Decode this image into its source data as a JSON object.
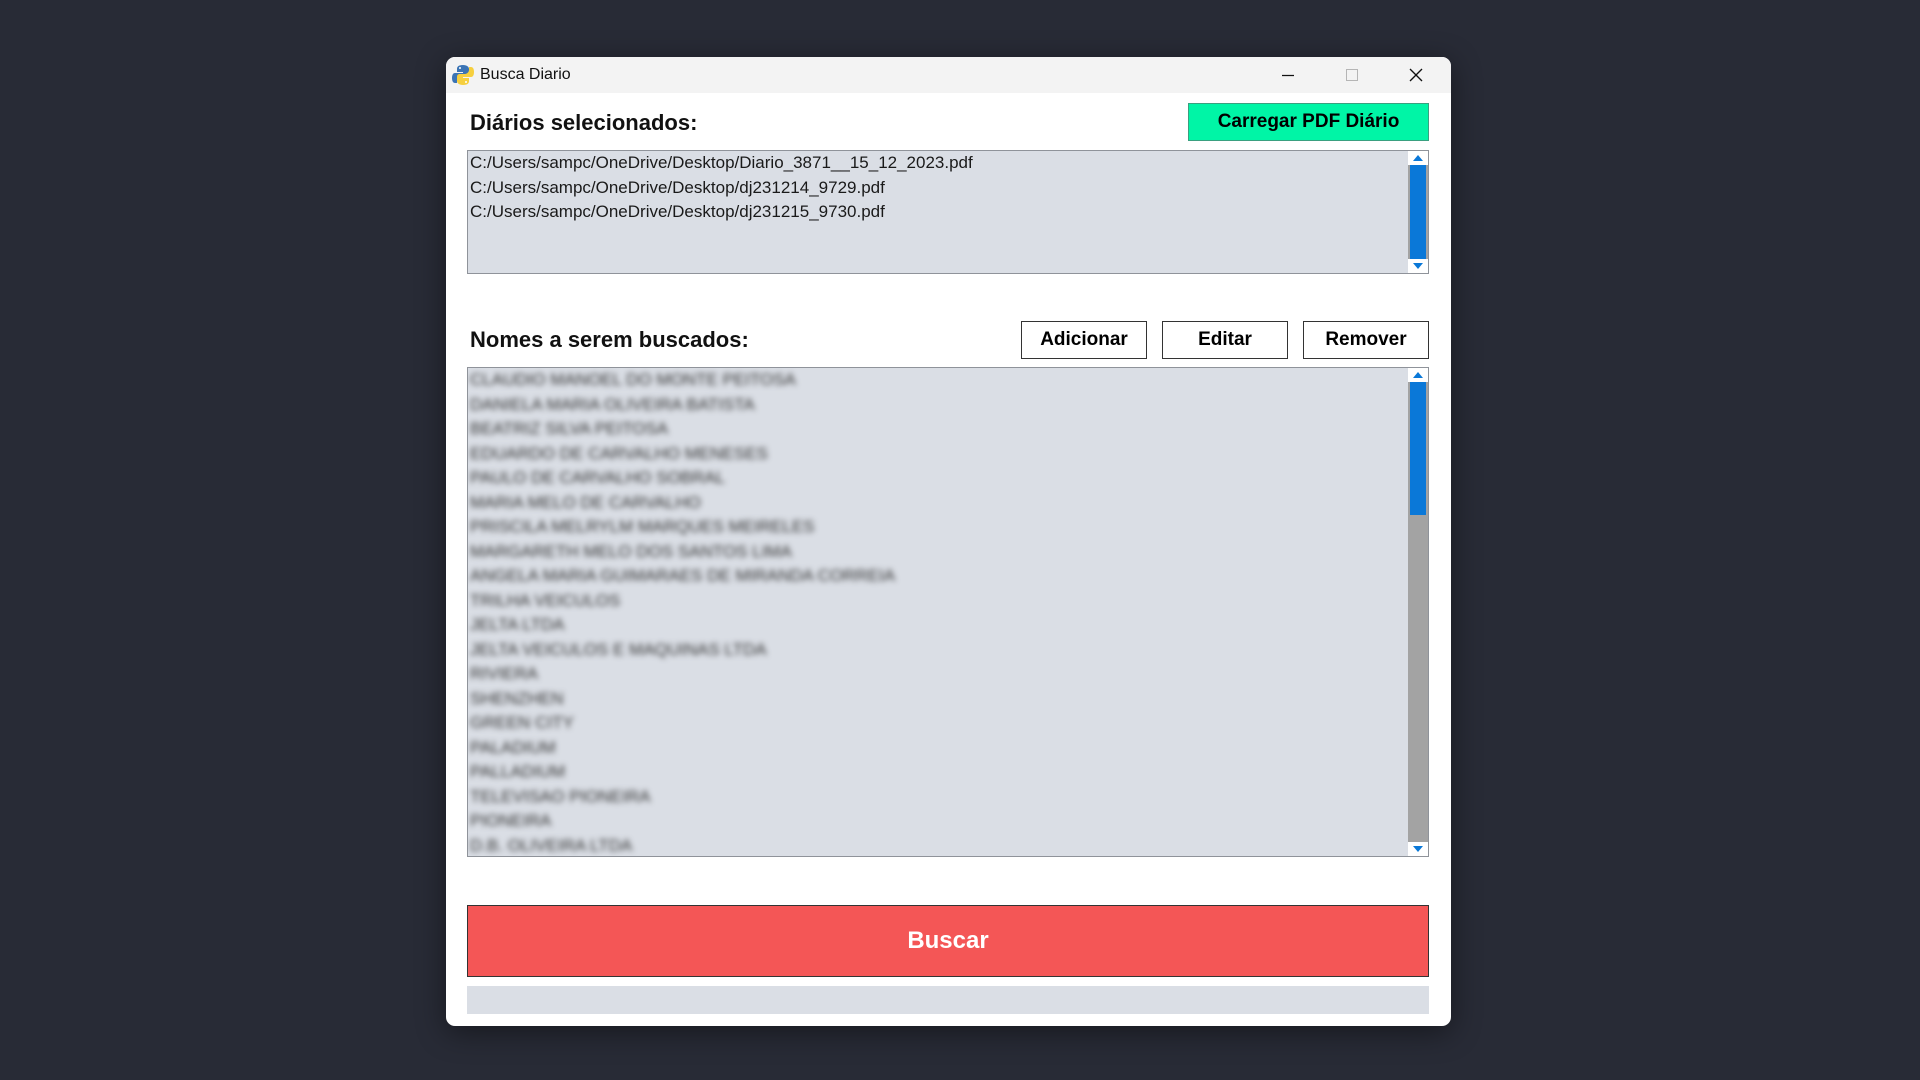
{
  "window": {
    "title": "Busca Diario",
    "controls": {
      "minimize": "minimize",
      "maximize": "maximize",
      "close": "close"
    }
  },
  "diarios": {
    "label": "Diários selecionados:",
    "load_button": "Carregar PDF Diário",
    "files": [
      "C:/Users/sampc/OneDrive/Desktop/Diario_3871__15_12_2023.pdf",
      "C:/Users/sampc/OneDrive/Desktop/dj231214_9729.pdf",
      "C:/Users/sampc/OneDrive/Desktop/dj231215_9730.pdf"
    ]
  },
  "nomes": {
    "label": "Nomes a serem buscados:",
    "add_button": "Adicionar",
    "edit_button": "Editar",
    "remove_button": "Remover",
    "items": [
      "CLAUDIO MANOEL DO MONTE PEITOSA",
      "DANIELA MARIA OLIVEIRA BATISTA",
      "BEATRIZ SILVA PEITOSA",
      "EDUARDO DE CARVALHO MENESES",
      "PAULO DE CARVALHO SOBRAL",
      "MARIA MELO DE CARVALHO",
      "PRISCILA MELRYLM MARQUES MEIRELES",
      "MARGARETH MELO DOS SANTOS LIMA",
      "ANGELA MARIA GUIMARAES DE MIRANDA CORREIA",
      "TRILHA VEICULOS",
      "JELTA LTDA",
      "JELTA VEICULOS E MAQUINAS LTDA",
      "RIVIERA",
      "SHENZHEN",
      "GREEN CITY",
      "PALADIUM",
      "PALLADIUM",
      "TELEVISAO PIONEIRA",
      "PIONEIRA",
      "D.B. OLIVEIRA LTDA"
    ],
    "scroll_fraction": 0.29
  },
  "actions": {
    "search_button": "Buscar",
    "progress": 0
  },
  "colors": {
    "load_button_bg": "#00f5a6",
    "search_button_bg": "#f45656",
    "scroll_thumb": "#0a78d8",
    "list_bg": "#dadee5"
  }
}
